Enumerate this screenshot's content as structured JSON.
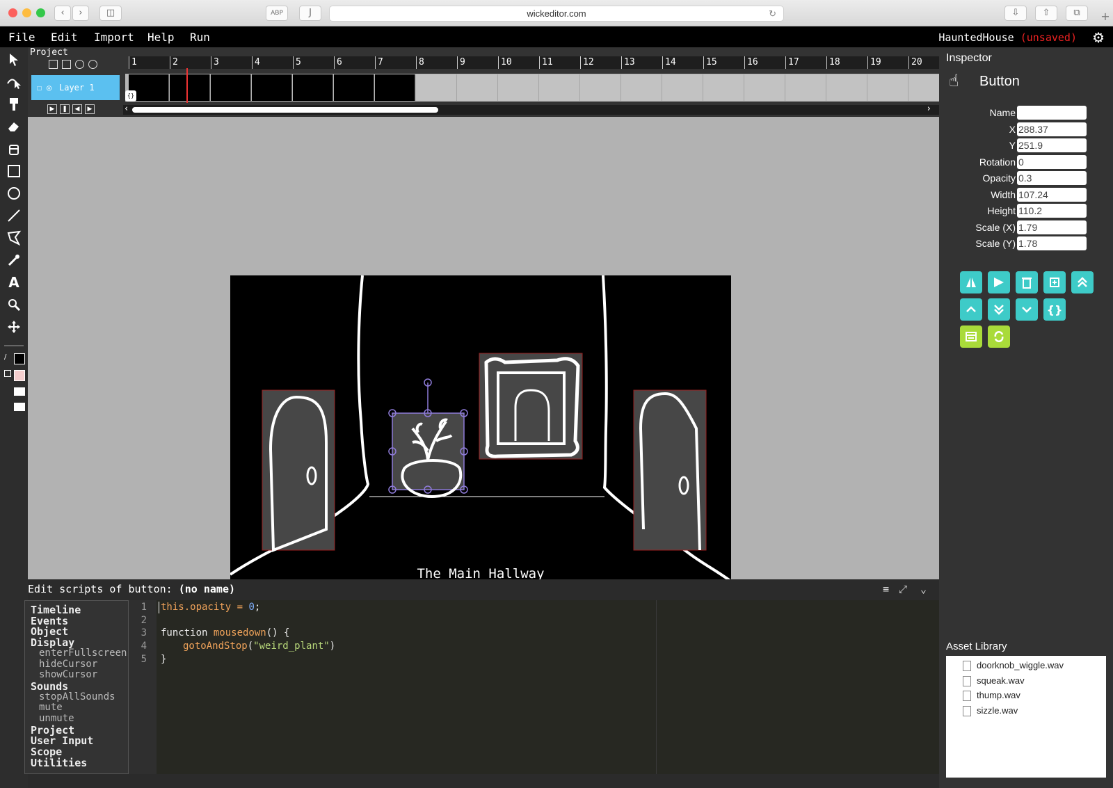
{
  "browser": {
    "url": "wickeditor.com"
  },
  "menu": {
    "items": [
      "File",
      "Edit",
      "Import",
      "Help",
      "Run"
    ],
    "project_name": "HauntedHouse",
    "unsaved_label": "(unsaved)"
  },
  "timeline": {
    "label": "Project",
    "layer_name": "Layer 1",
    "frame_numbers": [
      "1",
      "2",
      "3",
      "4",
      "5",
      "6",
      "7",
      "8",
      "9",
      "10",
      "11",
      "12",
      "13",
      "14",
      "15",
      "16",
      "17",
      "18",
      "19",
      "20"
    ],
    "playhead_frame": 2.5
  },
  "canvas": {
    "scene_title": "The Main Hallway"
  },
  "inspector": {
    "title": "Inspector",
    "object_type": "Button",
    "fields": [
      {
        "label": "Name",
        "value": ""
      },
      {
        "label": "X",
        "value": "288.37"
      },
      {
        "label": "Y",
        "value": "251.9"
      },
      {
        "label": "Rotation",
        "value": "0"
      },
      {
        "label": "Opacity",
        "value": "0.3"
      },
      {
        "label": "Width",
        "value": "107.24"
      },
      {
        "label": "Height",
        "value": "110.2"
      },
      {
        "label": "Scale (X)",
        "value": "1.79"
      },
      {
        "label": "Scale (Y)",
        "value": "1.78"
      }
    ]
  },
  "assets": {
    "title": "Asset Library",
    "files": [
      "doorknob_wiggle.wav",
      "squeak.wav",
      "thump.wav",
      "sizzle.wav"
    ]
  },
  "script_editor": {
    "header_prefix": "Edit scripts of button:",
    "header_name": "(no name)",
    "categories": [
      {
        "label": "Timeline",
        "type": "cat"
      },
      {
        "label": "Events",
        "type": "cat"
      },
      {
        "label": "Object",
        "type": "cat"
      },
      {
        "label": "Display",
        "type": "cat"
      },
      {
        "label": "enterFullscreen",
        "type": "sub"
      },
      {
        "label": "hideCursor",
        "type": "sub"
      },
      {
        "label": "showCursor",
        "type": "sub"
      },
      {
        "label": "Sounds",
        "type": "cat"
      },
      {
        "label": "stopAllSounds",
        "type": "sub"
      },
      {
        "label": "mute",
        "type": "sub"
      },
      {
        "label": "unmute",
        "type": "sub"
      },
      {
        "label": "Project",
        "type": "cat"
      },
      {
        "label": "User Input",
        "type": "cat"
      },
      {
        "label": "Scope",
        "type": "cat"
      },
      {
        "label": "Utilities",
        "type": "cat"
      }
    ],
    "line_numbers": [
      "1",
      "2",
      "3",
      "4",
      "5"
    ],
    "code": {
      "l1_a": "this.opacity = ",
      "l1_num": "0",
      "l1_b": ";",
      "l3_a": "function ",
      "l3_fn": "mousedown",
      "l3_b": "() {",
      "l4_fn": "gotoAndStop",
      "l4_a": "(",
      "l4_str": "\"weird_plant\"",
      "l4_b": ")",
      "l5": "}"
    }
  },
  "colors": {
    "accent_teal": "#3ecbc8",
    "accent_lime": "#a9db3a",
    "layer_blue": "#5bc0f0",
    "unsaved_red": "#e22222"
  }
}
